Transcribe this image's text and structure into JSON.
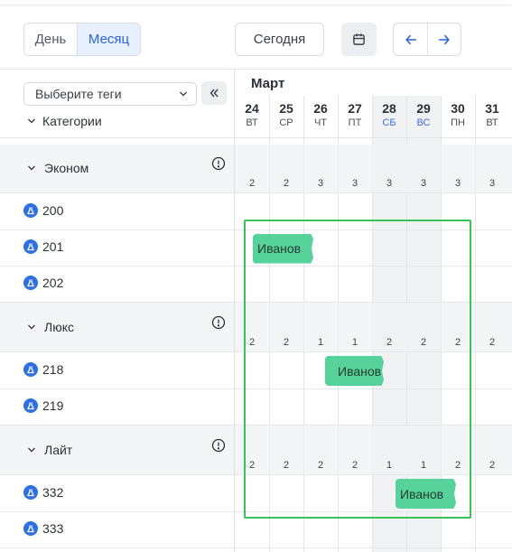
{
  "toolbar": {
    "view_day": "День",
    "view_month": "Месяц",
    "today": "Сегодня"
  },
  "sidebar": {
    "tags_placeholder": "Выберите теги",
    "categories_label": "Категории"
  },
  "calendar": {
    "month": "Март",
    "days": [
      {
        "num": "24",
        "wd": "ВТ",
        "weekend": false
      },
      {
        "num": "25",
        "wd": "СР",
        "weekend": false
      },
      {
        "num": "26",
        "wd": "ЧТ",
        "weekend": false
      },
      {
        "num": "27",
        "wd": "ПТ",
        "weekend": false
      },
      {
        "num": "28",
        "wd": "СБ",
        "weekend": true
      },
      {
        "num": "29",
        "wd": "ВС",
        "weekend": true
      },
      {
        "num": "30",
        "wd": "ПН",
        "weekend": false
      },
      {
        "num": "31",
        "wd": "ВТ",
        "weekend": false
      }
    ]
  },
  "groups": [
    {
      "name": "Эконом",
      "counts": [
        "2",
        "2",
        "3",
        "3",
        "3",
        "3",
        "3",
        "3"
      ],
      "rooms": [
        "200",
        "201",
        "202"
      ]
    },
    {
      "name": "Люкс",
      "counts": [
        "2",
        "2",
        "1",
        "1",
        "2",
        "2",
        "2",
        "2"
      ],
      "rooms": [
        "218",
        "219"
      ]
    },
    {
      "name": "Лайт",
      "counts": [
        "2",
        "2",
        "2",
        "2",
        "1",
        "1",
        "2",
        "2"
      ],
      "rooms": [
        "332",
        "333"
      ]
    }
  ],
  "bookings": [
    {
      "guest": "Иванов",
      "room": "201"
    },
    {
      "guest": "Иванов",
      "room": "218"
    },
    {
      "guest": "Иванов",
      "room": "332"
    }
  ],
  "colors": {
    "accent": "#2a64d8",
    "booking": "#58d29b",
    "selection": "#3ac15a",
    "room_icon": "#2f6fe0"
  }
}
